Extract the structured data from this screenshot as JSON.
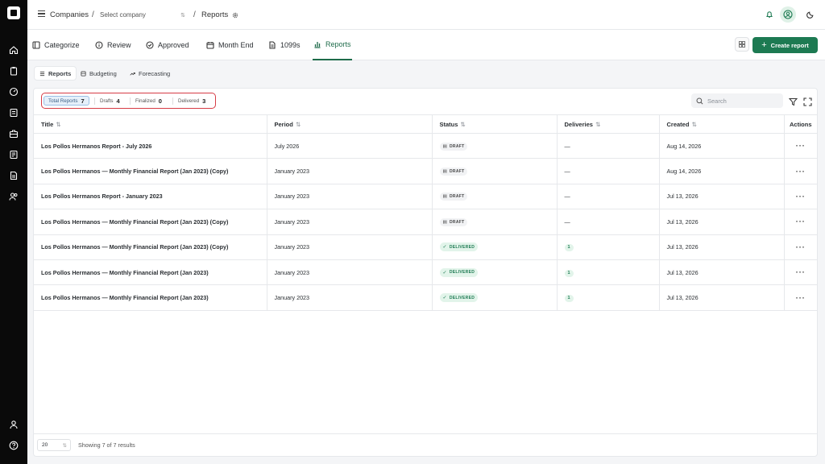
{
  "breadcrumb": {
    "companies": "Companies",
    "company_placeholder": "Select company",
    "current": "Reports",
    "separator": "/"
  },
  "tabs": [
    {
      "label": "Categorize",
      "icon": "categorize-icon"
    },
    {
      "label": "Review",
      "icon": "info-icon"
    },
    {
      "label": "Approved",
      "icon": "check-circle-icon"
    },
    {
      "label": "Month End",
      "icon": "calendar-icon"
    },
    {
      "label": "1099s",
      "icon": "document-icon"
    },
    {
      "label": "Reports",
      "icon": "bar-chart-icon",
      "active": true
    }
  ],
  "create_report_label": "Create report",
  "subtabs": [
    {
      "label": "Reports",
      "active": true
    },
    {
      "label": "Budgeting"
    },
    {
      "label": "Forecasting"
    }
  ],
  "filters": [
    {
      "label": "Total Reports",
      "count": "7",
      "active": true
    },
    {
      "label": "Drafts",
      "count": "4"
    },
    {
      "label": "Finalized",
      "count": "0"
    },
    {
      "label": "Delivered",
      "count": "3"
    }
  ],
  "search_placeholder": "Search",
  "columns": {
    "title": "Title",
    "period": "Period",
    "status": "Status",
    "deliveries": "Deliveries",
    "created": "Created",
    "actions": "Actions"
  },
  "rows": [
    {
      "title": "Los Pollos Hermanos Report - July 2026",
      "period": "July 2026",
      "status": "DRAFT",
      "deliveries": "—",
      "created": "Aug 14, 2026"
    },
    {
      "title": "Los Pollos Hermanos — Monthly Financial Report (Jan 2023) (Copy)",
      "period": "January 2023",
      "status": "DRAFT",
      "deliveries": "—",
      "created": "Aug 14, 2026"
    },
    {
      "title": "Los Pollos Hermanos Report - January 2023",
      "period": "January 2023",
      "status": "DRAFT",
      "deliveries": "—",
      "created": "Jul 13, 2026"
    },
    {
      "title": "Los Pollos Hermanos — Monthly Financial Report (Jan 2023) (Copy)",
      "period": "January 2023",
      "status": "DRAFT",
      "deliveries": "—",
      "created": "Jul 13, 2026"
    },
    {
      "title": "Los Pollos Hermanos — Monthly Financial Report (Jan 2023) (Copy)",
      "period": "January 2023",
      "status": "DELIVERED",
      "deliveries": "1",
      "created": "Jul 13, 2026"
    },
    {
      "title": "Los Pollos Hermanos — Monthly Financial Report (Jan 2023)",
      "period": "January 2023",
      "status": "DELIVERED",
      "deliveries": "1",
      "created": "Jul 13, 2026"
    },
    {
      "title": "Los Pollos Hermanos — Monthly Financial Report (Jan 2023)",
      "period": "January 2023",
      "status": "DELIVERED",
      "deliveries": "1",
      "created": "Jul 13, 2026"
    }
  ],
  "footer": {
    "page_size": "20",
    "showing": "Showing 7 of 7 results"
  },
  "colors": {
    "accent": "#1d7a52",
    "highlight_border": "#d63b45",
    "rail": "#0a0a0a"
  }
}
